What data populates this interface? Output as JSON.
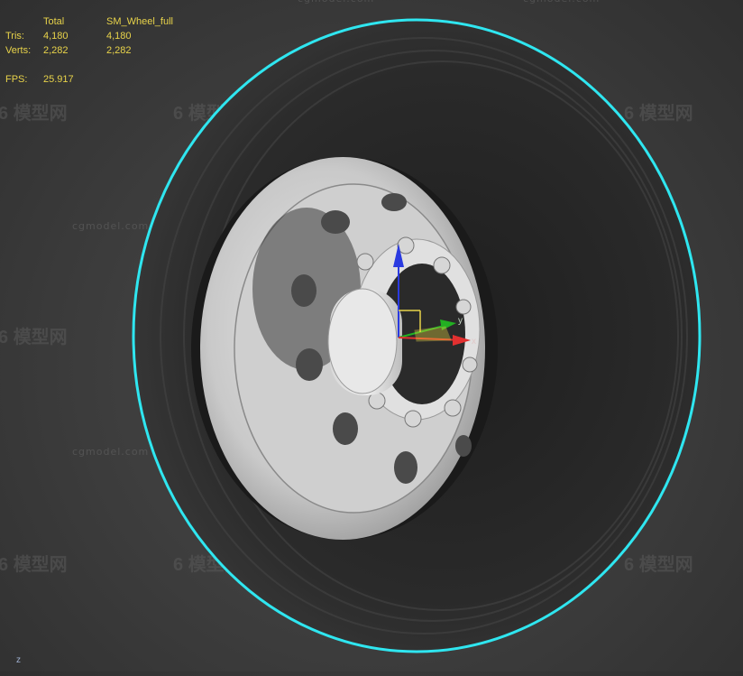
{
  "stats": {
    "header_total": "Total",
    "header_object": "SM_Wheel_full",
    "tris_label": "Tris:",
    "tris_total": "4,180",
    "tris_object": "4,180",
    "verts_label": "Verts:",
    "verts_total": "2,282",
    "verts_object": "2,282",
    "fps_label": "FPS:",
    "fps_value": "25.917"
  },
  "gizmo": {
    "x_label": "x",
    "y_label": "y"
  },
  "viewport": {
    "axis_indicator_label": "z"
  },
  "watermark": {
    "site": "cgmodel.com",
    "brand": "模型网"
  },
  "colors": {
    "selection_outline": "#2fe6f0",
    "stats_text": "#e8d34a",
    "gizmo_x": "#e23030",
    "gizmo_y": "#22b022",
    "gizmo_z": "#2a3ae0"
  }
}
